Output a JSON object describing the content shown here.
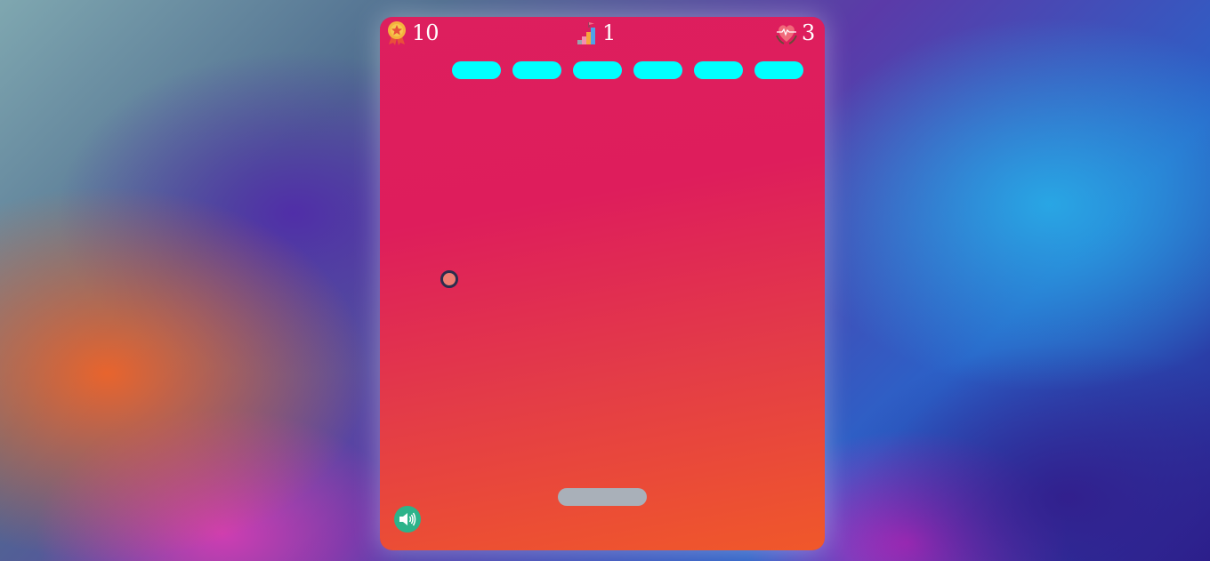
{
  "hud": {
    "score": {
      "icon": "medal-icon",
      "value": "10"
    },
    "level": {
      "icon": "stairs-icon",
      "value": "1"
    },
    "lives": {
      "icon": "heart-hands-icon",
      "value": "3"
    }
  },
  "bricks": [
    {
      "color": "#00ffff"
    },
    {
      "color": "#00ffff"
    },
    {
      "color": "#00ffff"
    },
    {
      "color": "#00ffff"
    },
    {
      "color": "#00ffff"
    },
    {
      "color": "#00ffff"
    }
  ],
  "ball": {
    "fill": "#f07d72",
    "outline": "#2b2d4e"
  },
  "paddle": {
    "color": "#a9b0b9"
  },
  "sound": {
    "icon": "speaker-icon",
    "state": "on",
    "color": "#2db38a"
  },
  "colors": {
    "board_top": "#dd1f5e",
    "board_bottom": "#f0582a",
    "text": "#ffffff"
  }
}
